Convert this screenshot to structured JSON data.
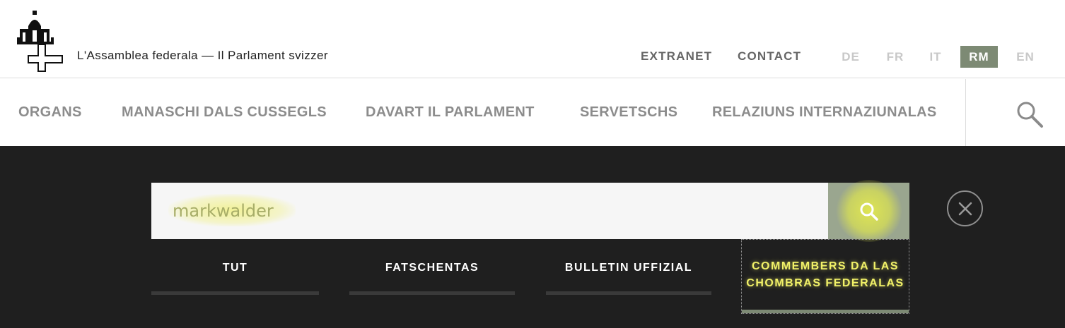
{
  "header": {
    "site_title": "L'Assamblea federala — Il Parlament svizzer",
    "extranet": "EXTRANET",
    "contact": "CONTACT",
    "languages": [
      "DE",
      "FR",
      "IT",
      "RM",
      "EN"
    ],
    "active_language": "RM"
  },
  "nav": {
    "items": [
      "ORGANS",
      "MANASCHI DALS CUSSEGLS",
      "DAVART IL PARLAMENT",
      "SERVETSCHS",
      "RELAZIUNS INTERNAZIUNALAS"
    ]
  },
  "search": {
    "value": "markwalder",
    "tabs": [
      "TUT",
      "FATSCHENTAS",
      "BULLETIN UFFIZIAL",
      "COMMEMBERS DA LAS CHOMBRAS FEDERALAS"
    ],
    "active_tab": "COMMEMBERS DA LAS CHOMBRAS FEDERALAS"
  },
  "colors": {
    "accent": "#7d8a74",
    "overlay_bg": "#1f1f1f",
    "highlight": "#f1f168"
  }
}
